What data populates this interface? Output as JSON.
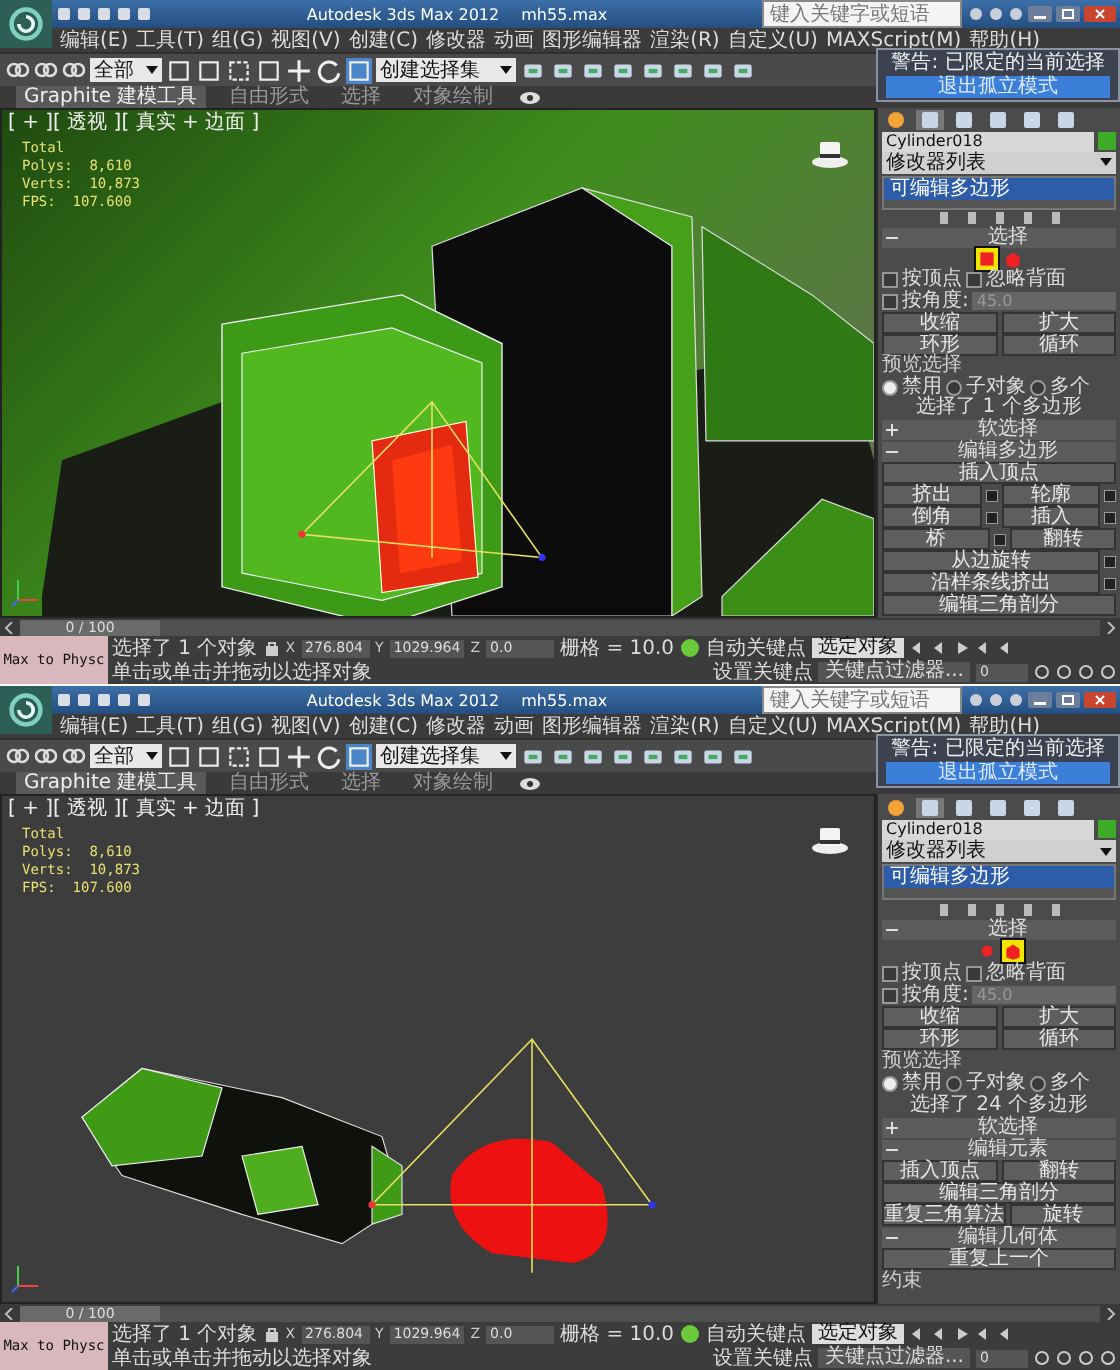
{
  "screens": [
    {
      "kind": "closeup",
      "title": "Autodesk 3ds Max 2012",
      "file": "mh55.max",
      "search": {
        "placeholder": "键入关键字或短语"
      },
      "menu": [
        "编辑(E)",
        "工具(T)",
        "组(G)",
        "视图(V)",
        "创建(C)",
        "修改器",
        "动画",
        "图形编辑器",
        "渲染(R)",
        "自定义(U)",
        "MAXScript(M)",
        "帮助(H)"
      ],
      "toolbar": {
        "dropdowns": [
          "全部",
          "创建选择集"
        ]
      },
      "ribbon_tabs": [
        {
          "label": "Graphite 建模工具",
          "selected": true
        },
        {
          "label": "自由形式",
          "selected": false
        },
        {
          "label": "选择",
          "selected": false
        },
        {
          "label": "对象绘制",
          "selected": false
        }
      ],
      "popup": {
        "title": "警告: 已限定的当前选择",
        "button": "退出孤立模式"
      },
      "viewport": {
        "label": "[ + ][ 透视 ][ 真实 + 边面 ]",
        "stats": [
          "Total",
          "Polys:  8,610",
          "Verts:  10,873",
          "FPS:  107.600"
        ]
      },
      "panel": {
        "tabs": [
          {
            "selected": false
          },
          {
            "selected": true
          },
          {
            "selected": false
          },
          {
            "selected": false
          },
          {
            "selected": false
          },
          {
            "selected": false
          }
        ],
        "object_name": "Cylinder018",
        "modifier_list": "修改器列表",
        "stack": [
          {
            "label": "可编辑多边形",
            "selected": true
          }
        ],
        "rows": [
          {
            "kind": "header",
            "label": "选择",
            "expanded": true
          },
          {
            "kind": "subobjects",
            "items": [
              {
                "kind": "polygon",
                "selected": true
              },
              {
                "kind": "element",
                "selected": false
              }
            ]
          },
          {
            "kind": "checks",
            "items": [
              {
                "label": "按顶点",
                "checked": false
              },
              {
                "label": "忽略背面",
                "checked": false
              }
            ]
          },
          {
            "kind": "spinner",
            "label": "按角度:",
            "checked": false,
            "value": "45.0"
          },
          {
            "kind": "buttons",
            "buttons": [
              {
                "label": "收缩",
                "settings": false
              },
              {
                "label": "扩大",
                "settings": false
              }
            ]
          },
          {
            "kind": "buttons",
            "buttons": [
              {
                "label": "环形",
                "settings": false
              },
              {
                "label": "循环",
                "settings": false
              }
            ]
          },
          {
            "kind": "label",
            "text": "预览选择"
          },
          {
            "kind": "radios",
            "options": [
              {
                "label": "禁用",
                "selected": true
              },
              {
                "label": "子对象",
                "selected": false
              },
              {
                "label": "多个",
                "selected": false
              }
            ]
          },
          {
            "kind": "text",
            "text": "选择了 1 个多边形"
          },
          {
            "kind": "header",
            "label": "软选择",
            "expanded": false
          },
          {
            "kind": "header",
            "label": "编辑多边形",
            "expanded": true
          },
          {
            "kind": "buttons",
            "buttons": [
              {
                "label": "插入顶点",
                "settings": false
              }
            ]
          },
          {
            "kind": "buttons",
            "buttons": [
              {
                "label": "挤出",
                "settings": true
              },
              {
                "label": "轮廓",
                "settings": true
              }
            ]
          },
          {
            "kind": "buttons",
            "buttons": [
              {
                "label": "倒角",
                "settings": true
              },
              {
                "label": "插入",
                "settings": true
              }
            ]
          },
          {
            "kind": "buttons",
            "buttons": [
              {
                "label": "桥",
                "settings": true
              },
              {
                "label": "翻转",
                "settings": false
              }
            ]
          },
          {
            "kind": "buttons",
            "buttons": [
              {
                "label": "从边旋转",
                "settings": true
              }
            ]
          },
          {
            "kind": "buttons",
            "buttons": [
              {
                "label": "沿样条线挤出",
                "settings": true
              }
            ]
          },
          {
            "kind": "buttons",
            "buttons": [
              {
                "label": "编辑三角剖分",
                "settings": false
              }
            ]
          }
        ]
      },
      "timeline": {
        "position": "0 / 100",
        "level": 0
      },
      "status": {
        "script_box": "Max to Physc",
        "selection": "选择了 1 个对象",
        "prompt": "单击或单击并拖动以选择对象",
        "coords": [
          {
            "axis": "X",
            "value": "276.804"
          },
          {
            "axis": "Y",
            "value": "1029.964"
          },
          {
            "axis": "Z",
            "value": "0.0"
          }
        ],
        "grid": "栅格 = 10.0",
        "auto_key": "自动关键点",
        "key_mode": "选定对象",
        "set_key": "设置关键点",
        "key_filters": "关键点过滤器...",
        "frame": "0"
      }
    },
    {
      "kind": "overview",
      "title": "Autodesk 3ds Max 2012",
      "file": "mh55.max",
      "search": {
        "placeholder": "键入关键字或短语"
      },
      "menu": [
        "编辑(E)",
        "工具(T)",
        "组(G)",
        "视图(V)",
        "创建(C)",
        "修改器",
        "动画",
        "图形编辑器",
        "渲染(R)",
        "自定义(U)",
        "MAXScript(M)",
        "帮助(H)"
      ],
      "toolbar": {
        "dropdowns": [
          "全部",
          "创建选择集"
        ]
      },
      "ribbon_tabs": [
        {
          "label": "Graphite 建模工具",
          "selected": true
        },
        {
          "label": "自由形式",
          "selected": false
        },
        {
          "label": "选择",
          "selected": false
        },
        {
          "label": "对象绘制",
          "selected": false
        }
      ],
      "popup": {
        "title": "警告: 已限定的当前选择",
        "button": "退出孤立模式"
      },
      "viewport": {
        "label": "[ + ][ 透视 ][ 真实 + 边面 ]",
        "stats": [
          "Total",
          "Polys:  8,610",
          "Verts:  10,873",
          "FPS:  107.600"
        ]
      },
      "panel": {
        "tabs": [
          {
            "selected": false
          },
          {
            "selected": true
          },
          {
            "selected": false
          },
          {
            "selected": false
          },
          {
            "selected": false
          },
          {
            "selected": false
          }
        ],
        "object_name": "Cylinder018",
        "modifier_list": "修改器列表",
        "stack": [
          {
            "label": "可编辑多边形",
            "selected": true
          }
        ],
        "rows": [
          {
            "kind": "header",
            "label": "选择",
            "expanded": true
          },
          {
            "kind": "subobjects",
            "items": [
              {
                "kind": "dot",
                "selected": false
              },
              {
                "kind": "element",
                "selected": true
              }
            ]
          },
          {
            "kind": "checks",
            "items": [
              {
                "label": "按顶点",
                "checked": false
              },
              {
                "label": "忽略背面",
                "checked": false
              }
            ]
          },
          {
            "kind": "spinner",
            "label": "按角度:",
            "checked": false,
            "value": "45.0"
          },
          {
            "kind": "buttons",
            "buttons": [
              {
                "label": "收缩",
                "settings": false
              },
              {
                "label": "扩大",
                "settings": false
              }
            ]
          },
          {
            "kind": "buttons",
            "buttons": [
              {
                "label": "环形",
                "settings": false
              },
              {
                "label": "循环",
                "settings": false
              }
            ]
          },
          {
            "kind": "label",
            "text": "预览选择"
          },
          {
            "kind": "radios",
            "options": [
              {
                "label": "禁用",
                "selected": true
              },
              {
                "label": "子对象",
                "selected": false
              },
              {
                "label": "多个",
                "selected": false
              }
            ]
          },
          {
            "kind": "text",
            "text": "选择了 24 个多边形"
          },
          {
            "kind": "header",
            "label": "软选择",
            "expanded": false
          },
          {
            "kind": "header",
            "label": "编辑元素",
            "expanded": true
          },
          {
            "kind": "buttons",
            "buttons": [
              {
                "label": "插入顶点",
                "settings": false
              },
              {
                "label": "翻转",
                "settings": false
              }
            ]
          },
          {
            "kind": "buttons",
            "buttons": [
              {
                "label": "编辑三角剖分",
                "settings": false
              }
            ]
          },
          {
            "kind": "buttons",
            "buttons": [
              {
                "label": "重复三角算法",
                "settings": false
              },
              {
                "label": "旋转",
                "settings": false
              }
            ]
          },
          {
            "kind": "header",
            "label": "编辑几何体",
            "expanded": true
          },
          {
            "kind": "buttons",
            "buttons": [
              {
                "label": "重复上一个",
                "settings": false
              }
            ]
          },
          {
            "kind": "label",
            "text": "约束"
          }
        ]
      },
      "timeline": {
        "position": "0 / 100",
        "level": 0
      },
      "status": {
        "script_box": "Max to Physc",
        "selection": "选择了 1 个对象",
        "prompt": "单击或单击并拖动以选择对象",
        "coords": [
          {
            "axis": "X",
            "value": "276.804"
          },
          {
            "axis": "Y",
            "value": "1029.964"
          },
          {
            "axis": "Z",
            "value": "0.0"
          }
        ],
        "grid": "栅格 = 10.0",
        "auto_key": "自动关键点",
        "key_mode": "选定对象",
        "set_key": "设置关键点",
        "key_filters": "关键点过滤器...",
        "frame": "0"
      }
    }
  ]
}
